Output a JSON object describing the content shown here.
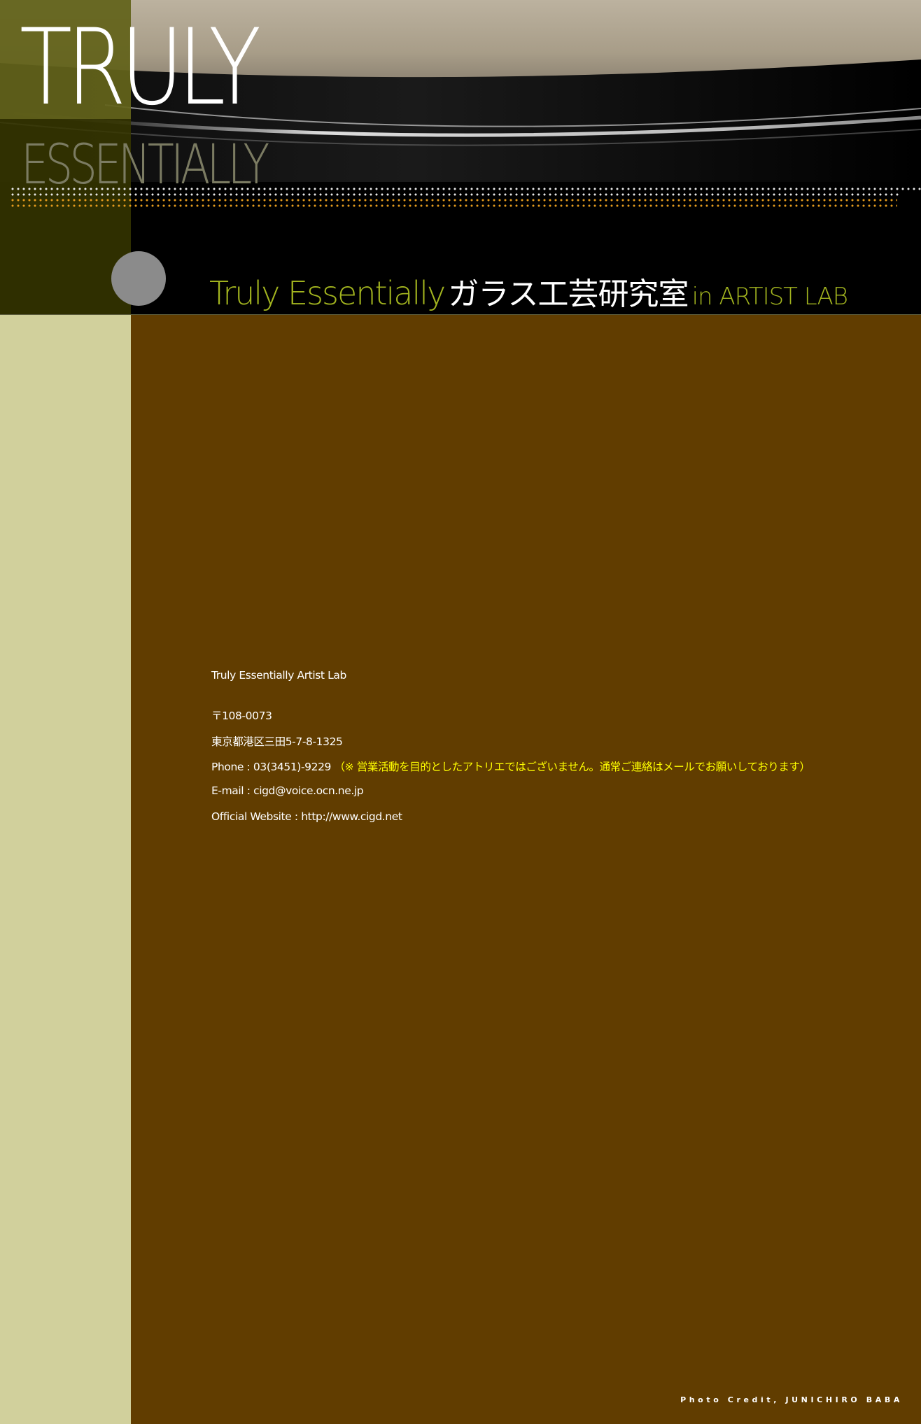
{
  "header": {
    "logo_top": "TRULY",
    "logo_bottom": "ESSENTIALLY",
    "tagline_en": "Truly Essentially",
    "tagline_jp": "ガラス工芸研究室",
    "tagline_lab": "in ARTIST LAB"
  },
  "contact": {
    "name": "Truly Essentially Artist Lab",
    "postal": "〒108-0073",
    "address": "東京都港区三田5-7-8-1325",
    "phone": "Phone : 03(3451)-9229",
    "phone_note": "（※ 営業活動を目的としたアトリエではございません。通常ご連絡はメールでお願いしております）",
    "email": "E-mail : cigd@voice.ocn.ne.jp",
    "website": "Official Website : http://www.cigd.net"
  },
  "footer": {
    "credit": "Photo Credit, JUNICHIRO BABA"
  },
  "colors": {
    "main_background": "#613d00",
    "left_column": "#d1d09c",
    "accent_green": "#a3b51f",
    "note_yellow": "#ffff00",
    "dot_orange": "#e39a1d"
  }
}
